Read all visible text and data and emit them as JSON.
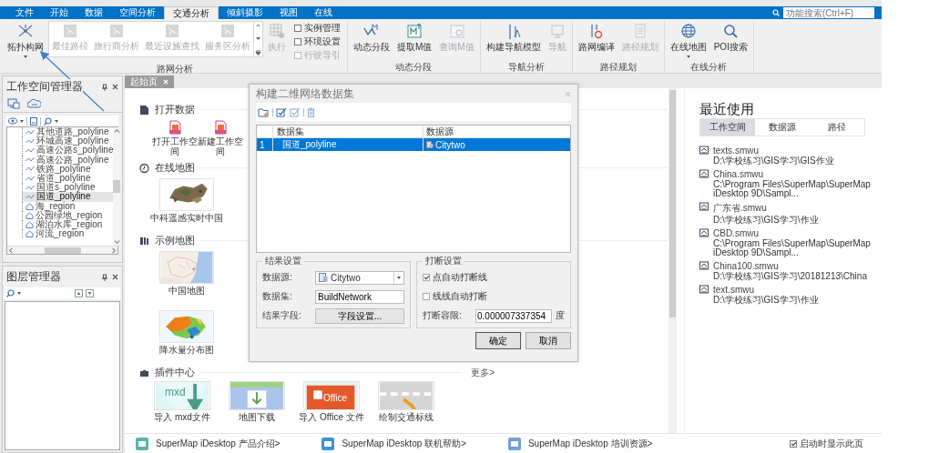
{
  "menu_tabs": [
    {
      "label": "文件",
      "selected": false
    },
    {
      "label": "开始",
      "selected": false
    },
    {
      "label": "数据",
      "selected": false
    },
    {
      "label": "空间分析",
      "selected": false
    },
    {
      "label": "交通分析",
      "selected": true
    },
    {
      "label": "倾斜摄影",
      "selected": false
    },
    {
      "label": "视图",
      "selected": false
    },
    {
      "label": "在线",
      "selected": false
    }
  ],
  "search": {
    "placeholder": "功能搜索(Ctrl+F)"
  },
  "ribbon": [
    {
      "title": "路网分析",
      "controls": [
        {
          "kind": "large",
          "label": "拓扑构网",
          "dropdown": true,
          "disabled": false
        },
        {
          "kind": "gallery",
          "items": [
            {
              "label": "最佳路径",
              "disabled": true
            },
            {
              "label": "旅行商分析",
              "disabled": true
            },
            {
              "label": "最近设施查找",
              "disabled": true
            },
            {
              "label": "服务区分析",
              "disabled": true
            }
          ]
        },
        {
          "kind": "large",
          "label": "执行",
          "dropdown": false,
          "disabled": true
        },
        {
          "kind": "checks",
          "items": [
            {
              "label": "实例管理",
              "checked": false,
              "disabled": false
            },
            {
              "label": "环境设置",
              "checked": false,
              "disabled": false
            },
            {
              "label": "行驶导引",
              "checked": false,
              "disabled": true
            }
          ]
        }
      ]
    },
    {
      "title": "动态分段",
      "controls": [
        {
          "kind": "large",
          "label": "动态分段",
          "dropdown": false,
          "disabled": false
        },
        {
          "kind": "large",
          "label": "提取M值",
          "dropdown": false,
          "disabled": false
        },
        {
          "kind": "large",
          "label": "查询M值",
          "dropdown": false,
          "disabled": true
        }
      ]
    },
    {
      "title": "导航分析",
      "controls": [
        {
          "kind": "large",
          "label": "构建导航模型",
          "dropdown": false,
          "disabled": false
        },
        {
          "kind": "large",
          "label": "导航",
          "dropdown": false,
          "disabled": true
        }
      ]
    },
    {
      "title": "路径规划",
      "controls": [
        {
          "kind": "large",
          "label": "路网编译",
          "dropdown": false,
          "disabled": false
        },
        {
          "kind": "large",
          "label": "路径规划",
          "dropdown": false,
          "disabled": true
        }
      ]
    },
    {
      "title": "在线分析",
      "controls": [
        {
          "kind": "large",
          "label": "在线地图",
          "dropdown": true,
          "disabled": false
        },
        {
          "kind": "large",
          "label": "POI搜索",
          "dropdown": false,
          "disabled": false
        }
      ]
    }
  ],
  "workspace_manager": {
    "title": "工作空间管理器",
    "tree": [
      {
        "label": "其他道路_polyline",
        "kind": "line",
        "selected": false
      },
      {
        "label": "环城高速_polyline",
        "kind": "line",
        "selected": false
      },
      {
        "label": "高速公路s_polyline",
        "kind": "line",
        "selected": false
      },
      {
        "label": "高速公路_polyline",
        "kind": "line",
        "selected": false
      },
      {
        "label": "铁路_polyline",
        "kind": "line",
        "selected": false
      },
      {
        "label": "省道_polyline",
        "kind": "line",
        "selected": false
      },
      {
        "label": "国道s_polyline",
        "kind": "line",
        "selected": false
      },
      {
        "label": "国道_polyline",
        "kind": "line",
        "selected": true
      },
      {
        "label": "海_region",
        "kind": "region",
        "selected": false
      },
      {
        "label": "公园绿地_region",
        "kind": "region",
        "selected": false
      },
      {
        "label": "湖泊水库_region",
        "kind": "region",
        "selected": false
      },
      {
        "label": "河流_region",
        "kind": "region",
        "selected": false
      }
    ]
  },
  "layer_manager": {
    "title": "图层管理器"
  },
  "document_tabs": [
    {
      "label": "起始页",
      "selected": true
    }
  ],
  "start_page": {
    "sections": [
      {
        "title": "打开数据",
        "items": [
          {
            "kind": "file",
            "label": "打开工作空间"
          },
          {
            "kind": "file",
            "label": "新建工作空间"
          }
        ]
      },
      {
        "title": "在线地图",
        "items": [
          {
            "kind": "picture",
            "label": "中科遥感实时中国"
          }
        ]
      },
      {
        "title": "示例地图",
        "items": [
          {
            "kind": "picture",
            "label": "中国地图"
          },
          {
            "kind": "picture",
            "label": "降水量分布图"
          }
        ]
      },
      {
        "title": "插件中心",
        "more": "更多>",
        "items": [
          {
            "kind": "plugin",
            "label": "导入 mxd文件",
            "badge": "mxd"
          },
          {
            "kind": "plugin",
            "label": "地图下载"
          },
          {
            "kind": "plugin",
            "label": "导入 Office 文件",
            "badge": "Office"
          },
          {
            "kind": "plugin",
            "label": "绘制交通标线"
          }
        ]
      }
    ]
  },
  "recent": {
    "title": "最近使用",
    "tabs": [
      {
        "label": "工作空间",
        "selected": true
      },
      {
        "label": "数据源",
        "selected": false
      },
      {
        "label": "路径",
        "selected": false
      }
    ],
    "items": [
      {
        "name": "texts.smwu",
        "path": "D:\\学校练习\\GIS学习\\GIS作业"
      },
      {
        "name": "China.smwu",
        "path": "C:\\Program Files\\SuperMap\\SuperMap iDesktop 9D\\Sampl..."
      },
      {
        "name": "广东省.smwu",
        "path": "D:\\学校练习\\GIS学习\\作业"
      },
      {
        "name": "CBD.smwu",
        "path": "C:\\Program Files\\SuperMap\\SuperMap iDesktop 9D\\Sampl..."
      },
      {
        "name": "China100.smwu",
        "path": "D:\\学校练习\\GIS学习\\20181213\\China"
      },
      {
        "name": "text.smwu",
        "path": "D:\\学校练习\\GIS学习\\作业"
      }
    ]
  },
  "footer": {
    "links": [
      "SuperMap iDesktop 产品介绍>",
      "SuperMap iDesktop 联机帮助>",
      "SuperMap iDesktop 培训资源>"
    ],
    "show_on_startup": {
      "label": "启动时显示此页",
      "checked": true
    }
  },
  "dialog": {
    "title": "构建二维网络数据集",
    "table": {
      "columns": [
        "数据集",
        "数据源"
      ],
      "rows": [
        {
          "index": "1",
          "dataset": "国道_polyline",
          "source": "Citytwo",
          "selected": true
        }
      ]
    },
    "result_group": {
      "title": "结果设置",
      "datasource_label": "数据源:",
      "datasource": "Citytwo",
      "dataset_label": "数据集:",
      "dataset": "BuildNetwork",
      "field_label": "结果字段:",
      "field_button": "字段设置..."
    },
    "break_group": {
      "title": "打断设置",
      "options": [
        {
          "label": "点自动打断线",
          "checked": true
        },
        {
          "label": "线线自动打断",
          "checked": false
        }
      ],
      "tolerance_label": "打断容限:",
      "tolerance": "0.000007337354",
      "unit": "度"
    },
    "buttons": [
      "确定",
      "取消"
    ]
  }
}
